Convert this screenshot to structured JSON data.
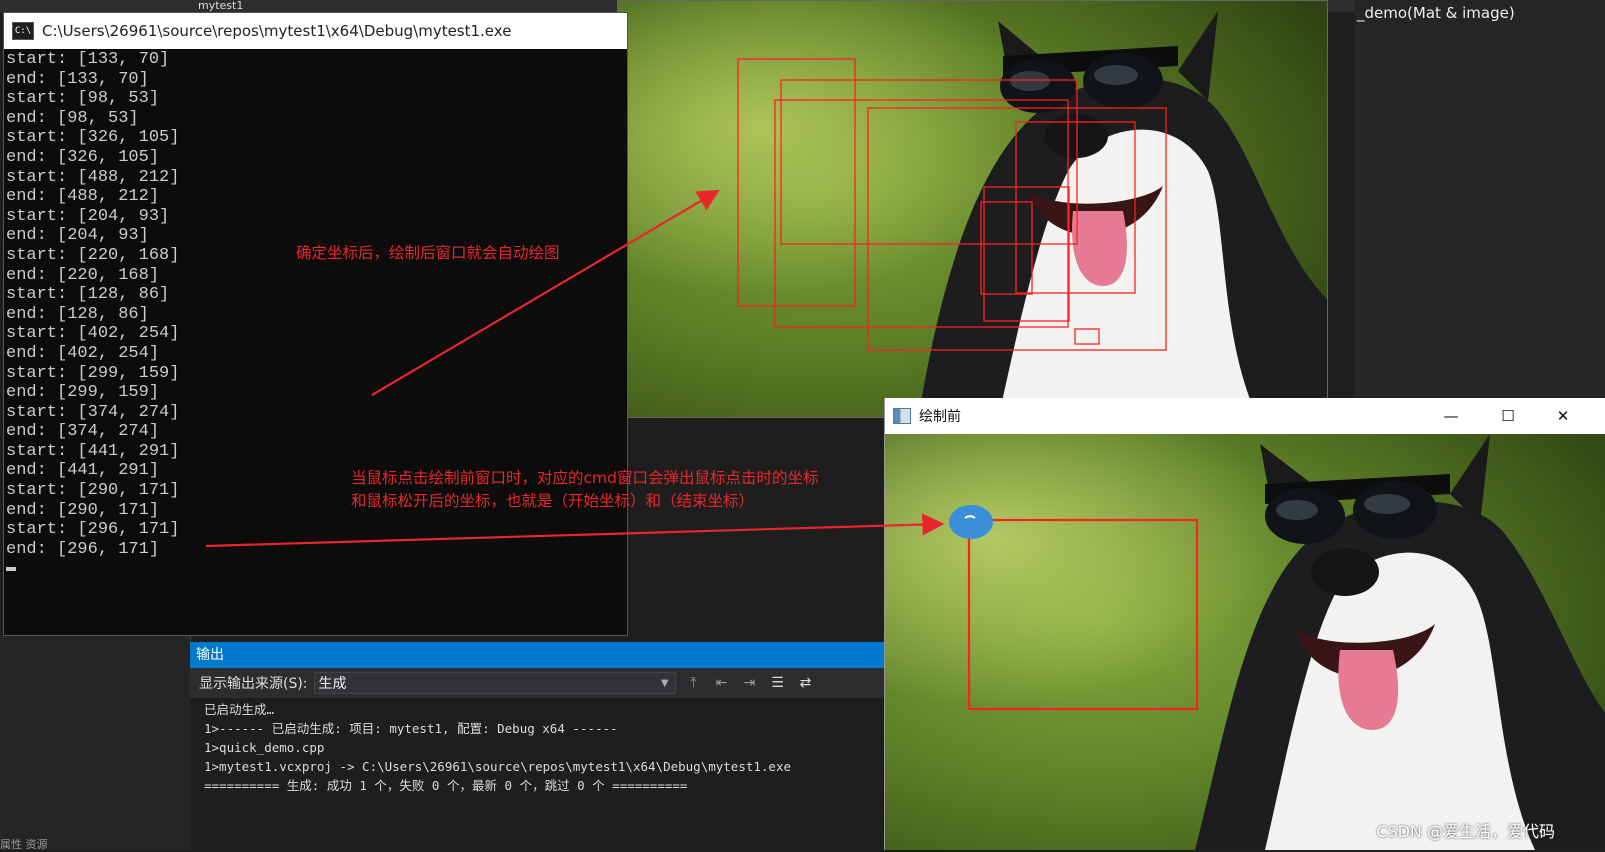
{
  "vs": {
    "tab_label": "mytest1",
    "right_title": "_demo(Mat & image)",
    "left_bottom": "属性   资源"
  },
  "cmd": {
    "title": "C:\\Users\\26961\\source\\repos\\mytest1\\x64\\Debug\\mytest1.exe",
    "icon_text": "C:\\",
    "lines": [
      "start: [133, 70]",
      "end: [133, 70]",
      "start: [98, 53]",
      "end: [98, 53]",
      "start: [326, 105]",
      "end: [326, 105]",
      "start: [488, 212]",
      "end: [488, 212]",
      "start: [204, 93]",
      "end: [204, 93]",
      "start: [220, 168]",
      "end: [220, 168]",
      "start: [128, 86]",
      "end: [128, 86]",
      "start: [402, 254]",
      "end: [402, 254]",
      "start: [299, 159]",
      "end: [299, 159]",
      "start: [374, 274]",
      "end: [374, 274]",
      "start: [441, 291]",
      "end: [441, 291]",
      "start: [290, 171]",
      "end: [290, 171]",
      "start: [296, 171]",
      "end: [296, 171]"
    ]
  },
  "output": {
    "header": "输出",
    "source_label": "显示输出来源(S):",
    "source_value": "生成",
    "lines": [
      "已启动生成…",
      "1>------ 已启动生成: 项目: mytest1, 配置: Debug x64 ------",
      "1>quick_demo.cpp",
      "1>mytest1.vcxproj -> C:\\Users\\26961\\source\\repos\\mytest1\\x64\\Debug\\mytest1.exe",
      "========== 生成: 成功 1 个，失败 0 个，最新 0 个，跳过 0 个 =========="
    ]
  },
  "before_window": {
    "title": "绘制前",
    "minimize": "—",
    "maximize": "☐",
    "close": "✕"
  },
  "annotations": {
    "a1": "确定坐标后，绘制后窗口就会自动绘图",
    "a2_line1": "当鼠标点击绘制前窗口时，对应的cmd窗口会弹出鼠标点击时的坐标",
    "a2_line2": "和鼠标松开后的坐标，也就是（开始坐标）和（结束坐标）"
  },
  "watermark": "CSDN @爱生活，爱代码",
  "colors": {
    "annotation_red": "#e8272c",
    "rect_red": "#ff2020",
    "vs_blue": "#007acc",
    "click_marker": "#3a8fd8"
  }
}
